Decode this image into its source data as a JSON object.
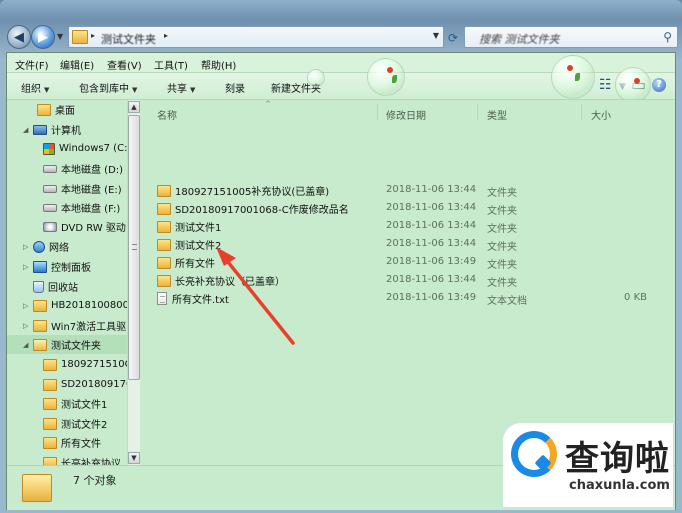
{
  "address_bar": {
    "path_segment": "测试文件夹",
    "search_placeholder": "搜索 测试文件夹"
  },
  "menu": [
    "文件(F)",
    "编辑(E)",
    "查看(V)",
    "工具(T)",
    "帮助(H)"
  ],
  "toolbar": {
    "organize": "组织",
    "include_in_library": "包含到库中",
    "share": "共享",
    "burn": "刻录",
    "new_folder": "新建文件夹"
  },
  "nav_items": [
    {
      "label": "桌面",
      "icon": "folder-icon"
    },
    {
      "label": "计算机",
      "icon": "computer-icon"
    },
    {
      "label": "Windows7 (C:",
      "icon": "windows-drive-icon"
    },
    {
      "label": "本地磁盘 (D:)",
      "icon": "drive-icon"
    },
    {
      "label": "本地磁盘 (E:)",
      "icon": "drive-icon"
    },
    {
      "label": "本地磁盘 (F:)",
      "icon": "drive-icon"
    },
    {
      "label": "DVD RW 驱动",
      "icon": "dvd-drive-icon"
    },
    {
      "label": "网络",
      "icon": "network-icon"
    },
    {
      "label": "控制面板",
      "icon": "control-panel-icon"
    },
    {
      "label": "回收站",
      "icon": "recycle-bin-icon"
    },
    {
      "label": "HB2018100800",
      "icon": "folder-icon"
    },
    {
      "label": "Win7激活工具驱",
      "icon": "folder-icon"
    },
    {
      "label": "测试文件夹",
      "icon": "folder-open-icon"
    },
    {
      "label": "1809271510C",
      "icon": "folder-icon"
    },
    {
      "label": "SD201809170",
      "icon": "folder-icon"
    },
    {
      "label": "测试文件1",
      "icon": "folder-icon"
    },
    {
      "label": "测试文件2",
      "icon": "folder-icon"
    },
    {
      "label": "所有文件",
      "icon": "folder-icon"
    },
    {
      "label": "长亮补充协议",
      "icon": "folder-icon"
    }
  ],
  "columns": {
    "name": "名称",
    "date": "修改日期",
    "type": "类型",
    "size": "大小"
  },
  "files": [
    {
      "name": "180927151005补充协议(已盖章)",
      "date": "2018-11-06 13:44",
      "type": "文件夹",
      "size": "",
      "icon": "folder-icon"
    },
    {
      "name": "SD20180917001068-C作废修改品名",
      "date": "2018-11-06 13:44",
      "type": "文件夹",
      "size": "",
      "icon": "folder-icon"
    },
    {
      "name": "测试文件1",
      "date": "2018-11-06 13:44",
      "type": "文件夹",
      "size": "",
      "icon": "folder-icon"
    },
    {
      "name": "测试文件2",
      "date": "2018-11-06 13:44",
      "type": "文件夹",
      "size": "",
      "icon": "folder-icon"
    },
    {
      "name": "所有文件",
      "date": "2018-11-06 13:49",
      "type": "文件夹",
      "size": "",
      "icon": "folder-icon"
    },
    {
      "name": "长亮补充协议（已盖章）",
      "date": "2018-11-06 13:44",
      "type": "文件夹",
      "size": "",
      "icon": "folder-icon"
    },
    {
      "name": "所有文件.txt",
      "date": "2018-11-06 13:49",
      "type": "文本文档",
      "size": "0 KB",
      "icon": "text-file-icon"
    }
  ],
  "status": {
    "item_count": "7 个对象"
  },
  "watermark": {
    "title": "查询啦",
    "site": "chaxunla.com"
  },
  "colors": {
    "window_bg": "#c8ebcd",
    "annotation_arrow": "#e8402a",
    "watermark_blue": "#1b8ae6"
  }
}
